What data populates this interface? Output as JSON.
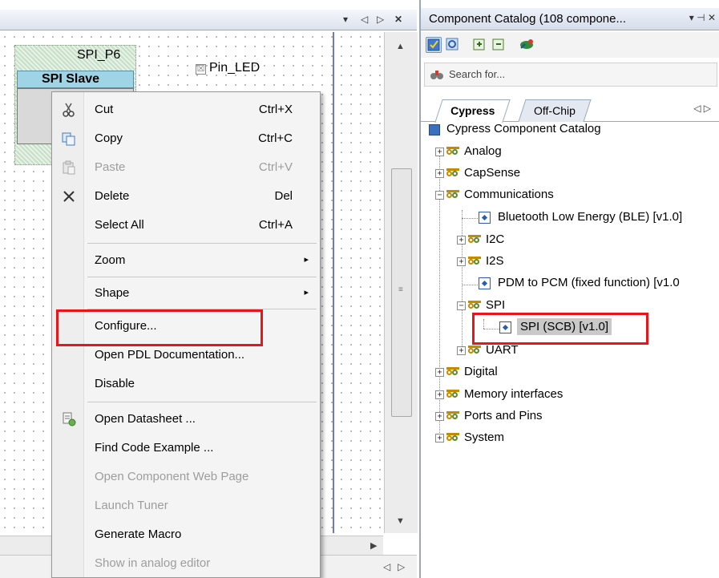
{
  "left_panel": {
    "title_buttons": [
      "▾",
      "◁",
      "▷",
      "✕"
    ],
    "component": {
      "instance_name": "SPI_P6",
      "type_label": "SPI Slave"
    },
    "pin": {
      "label": "Pin_LED",
      "checkbox_glyph": "☒"
    },
    "bottom_nav": [
      "◁",
      "▷"
    ]
  },
  "context_menu": {
    "items": [
      {
        "label": "Cut",
        "shortcut": "Ctrl+X",
        "icon": "scissors-icon",
        "enabled": true
      },
      {
        "label": "Copy",
        "shortcut": "Ctrl+C",
        "icon": "copy-icon",
        "enabled": true
      },
      {
        "label": "Paste",
        "shortcut": "Ctrl+V",
        "icon": "paste-icon",
        "enabled": false
      },
      {
        "label": "Delete",
        "shortcut": "Del",
        "icon": "delete-x-icon",
        "enabled": true
      },
      {
        "label": "Select All",
        "shortcut": "Ctrl+A",
        "enabled": true
      },
      {
        "label": "Zoom",
        "submenu": true,
        "enabled": true
      },
      {
        "label": "Shape",
        "submenu": true,
        "enabled": true
      },
      {
        "label": "Configure...",
        "enabled": true,
        "highlighted": true
      },
      {
        "label": "Open PDL Documentation...",
        "enabled": true
      },
      {
        "label": "Disable",
        "enabled": true
      },
      {
        "label": "Open Datasheet ...",
        "icon": "datasheet-icon",
        "enabled": true
      },
      {
        "label": "Find Code Example ...",
        "enabled": true
      },
      {
        "label": "Open Component Web Page",
        "enabled": false
      },
      {
        "label": "Launch Tuner",
        "enabled": false
      },
      {
        "label": "Generate Macro",
        "enabled": true
      },
      {
        "label": "Show in analog editor",
        "enabled": false
      }
    ],
    "submenu_glyph": "▸"
  },
  "catalog": {
    "title": "Component Catalog (108 compone...",
    "title_buttons": [
      "▾",
      "⊣",
      "✕"
    ],
    "search_placeholder": "Search for...",
    "tabs": [
      "Cypress",
      "Off-Chip"
    ],
    "tab_nav": "◁ ▷",
    "root": "Cypress Component Catalog",
    "tree": [
      {
        "label": "Analog",
        "expander": "+"
      },
      {
        "label": "CapSense",
        "expander": "+"
      },
      {
        "label": "Communications",
        "expander": "−"
      },
      {
        "label": "Bluetooth Low Energy (BLE) [v1.0]"
      },
      {
        "label": "I2C",
        "expander": "+"
      },
      {
        "label": "I2S",
        "expander": "+"
      },
      {
        "label": "PDM to PCM (fixed function) [v1.0"
      },
      {
        "label": "SPI",
        "expander": "−"
      },
      {
        "label": "SPI (SCB) [v1.0]",
        "selected": true,
        "highlighted": true
      },
      {
        "label": "UART",
        "expander": "+"
      },
      {
        "label": "Digital",
        "expander": "+"
      },
      {
        "label": "Memory interfaces",
        "expander": "+"
      },
      {
        "label": "Ports and Pins",
        "expander": "+"
      },
      {
        "label": "System",
        "expander": "+"
      }
    ]
  },
  "colors": {
    "highlight_red": "#e8151b",
    "selection_gray": "#c9c9c9",
    "component_header": "#9fd4e6"
  }
}
